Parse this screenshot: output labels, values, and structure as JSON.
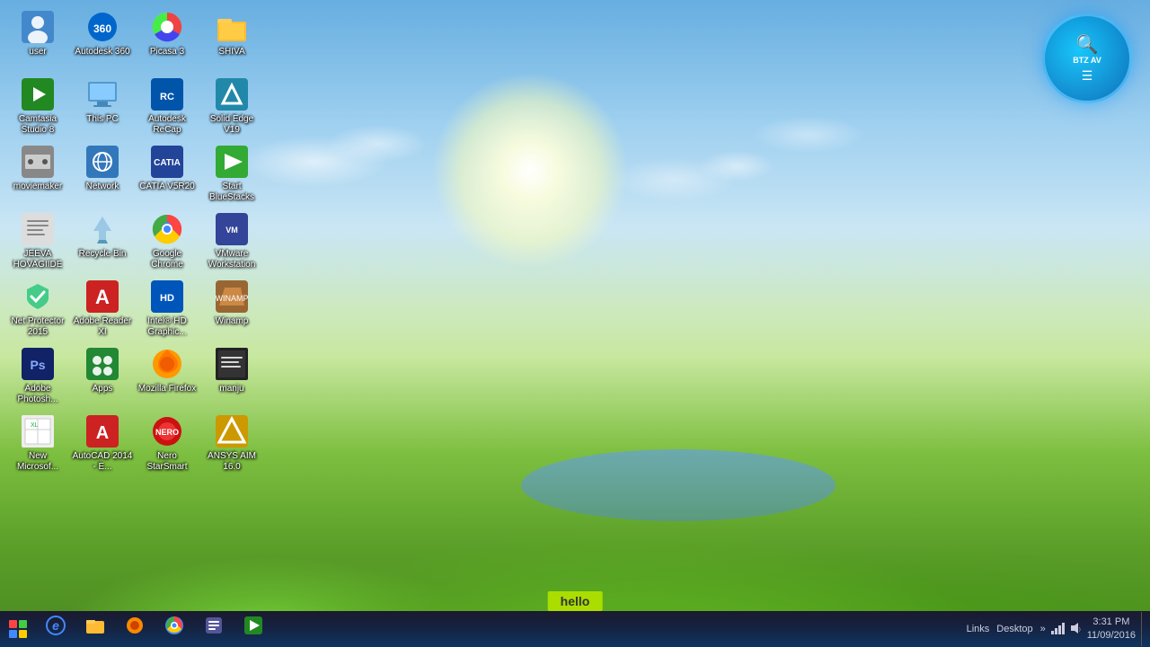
{
  "desktop": {
    "background": "windows-nature",
    "icons": [
      {
        "id": "user",
        "label": "user",
        "icon": "👤",
        "style": "icon-user"
      },
      {
        "id": "autodesk360",
        "label": "Autodesk 360",
        "icon": "🔵",
        "style": "icon-autodesk360"
      },
      {
        "id": "picasa3",
        "label": "Picasa 3",
        "icon": "🎨",
        "style": "icon-picasa"
      },
      {
        "id": "shiva",
        "label": "SHIVA",
        "icon": "📁",
        "style": "icon-folder-yellow"
      },
      {
        "id": "camtasia",
        "label": "Camtasia Studio 8",
        "icon": "🎬",
        "style": "icon-camtasia"
      },
      {
        "id": "thispc",
        "label": "This PC",
        "icon": "💻",
        "style": "icon-thispc"
      },
      {
        "id": "autodesk-recap",
        "label": "Autodesk ReCap",
        "icon": "🔷",
        "style": "icon-autodesk-recap"
      },
      {
        "id": "solid-edge",
        "label": "Solid Edge V19",
        "icon": "🔧",
        "style": "icon-solid-edge"
      },
      {
        "id": "moviemaker",
        "label": "moviemaker",
        "icon": "🎥",
        "style": "icon-moviemaker"
      },
      {
        "id": "network",
        "label": "Network",
        "icon": "🌐",
        "style": "icon-network"
      },
      {
        "id": "catia",
        "label": "CATIA V5R20",
        "icon": "🔺",
        "style": "icon-catia"
      },
      {
        "id": "bluestacks",
        "label": "Start BlueStacks",
        "icon": "▶",
        "style": "icon-bluestacks"
      },
      {
        "id": "jeeva",
        "label": "JEEVA HOVAGIIDE",
        "icon": "📄",
        "style": "icon-jeeva"
      },
      {
        "id": "recycle",
        "label": "Recycle Bin",
        "icon": "🗑",
        "style": "icon-recycle"
      },
      {
        "id": "chrome",
        "label": "Google Chrome",
        "icon": "🌐",
        "style": "icon-chrome"
      },
      {
        "id": "vmware",
        "label": "VMware Workstation",
        "icon": "🖥",
        "style": "icon-vmware"
      },
      {
        "id": "netprotector",
        "label": "Net Protector 2015",
        "icon": "🛡",
        "style": "icon-netprotector"
      },
      {
        "id": "adobe-reader",
        "label": "Adobe Reader XI",
        "icon": "📕",
        "style": "icon-adobe-reader"
      },
      {
        "id": "intel",
        "label": "Intel® HD Graphic...",
        "icon": "💎",
        "style": "icon-intel"
      },
      {
        "id": "winamp",
        "label": "Winamp",
        "icon": "🎵",
        "style": "icon-winamp"
      },
      {
        "id": "photoshop",
        "label": "Adobe Photosh...",
        "icon": "🖼",
        "style": "icon-photoshop"
      },
      {
        "id": "apps",
        "label": "Apps",
        "icon": "📦",
        "style": "icon-apps"
      },
      {
        "id": "mozilla",
        "label": "Mozilla Firefox",
        "icon": "🦊",
        "style": "icon-mozilla"
      },
      {
        "id": "manju",
        "label": "manju",
        "icon": "📁",
        "style": "icon-manju"
      },
      {
        "id": "excel",
        "label": "New Microsof...",
        "icon": "📊",
        "style": "icon-excel"
      },
      {
        "id": "autocad",
        "label": "AutoCAD 2014 - E...",
        "icon": "📐",
        "style": "icon-autocad"
      },
      {
        "id": "nero",
        "label": "Nero StarSmart",
        "icon": "⭐",
        "style": "icon-nero"
      },
      {
        "id": "ansys",
        "label": "ANSYS AIM 16.0",
        "icon": "🔺",
        "style": "icon-ansys"
      }
    ]
  },
  "taskbar": {
    "start_label": "Start",
    "apps": [
      {
        "id": "start",
        "icon": "⊞",
        "label": "Start"
      },
      {
        "id": "ie",
        "icon": "e",
        "label": "Internet Explorer",
        "active": false
      },
      {
        "id": "explorer",
        "icon": "📁",
        "label": "File Explorer",
        "active": false
      },
      {
        "id": "firefox",
        "icon": "🦊",
        "label": "Mozilla Firefox",
        "active": false
      },
      {
        "id": "chrome",
        "icon": "🌐",
        "label": "Google Chrome",
        "active": false
      },
      {
        "id": "taskmanager",
        "icon": "📋",
        "label": "Task Manager",
        "active": false
      },
      {
        "id": "camtasia",
        "icon": "🎬",
        "label": "Camtasia",
        "active": false
      }
    ],
    "notification": "hello",
    "tray": {
      "links": "Links",
      "desktop": "Desktop",
      "time": "3:31 PM",
      "date": "11/09/2016"
    }
  },
  "widget": {
    "search_icon": "🔍",
    "text": "BTZ AV",
    "menu_icon": "☰"
  }
}
